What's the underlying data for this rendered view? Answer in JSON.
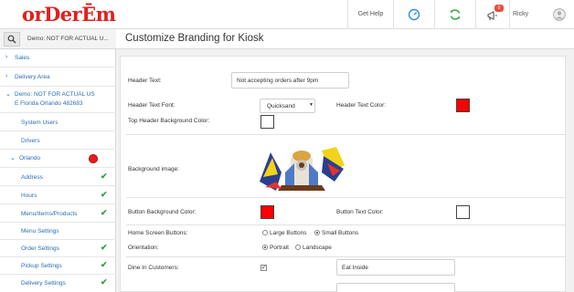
{
  "app": {
    "logo_text": "orDerĒm",
    "brand_color": "#e02020"
  },
  "topbar": {
    "help_label": "Get Help",
    "notification_count": "0",
    "user_name": "Ricky",
    "icons": [
      "speedometer-icon",
      "refresh-icon",
      "announcement-icon",
      "user-avatar-icon"
    ]
  },
  "sidebar": {
    "search_text": "Demo: NOT FOR ACTUAL U...",
    "items": [
      {
        "label": "Sales",
        "chevron": "›"
      },
      {
        "label": "Delivery Area",
        "chevron": "›"
      },
      {
        "label": "Demo: NOT FOR ACTUAL US",
        "label2": "E Florida Orlando 482683",
        "chevron": "⌄"
      },
      {
        "label": "System Users"
      },
      {
        "label": "Drivers"
      },
      {
        "label": "Orlando",
        "chevron": "⌄"
      },
      {
        "label": "Address",
        "check": "✔"
      },
      {
        "label": "Hours",
        "check": "✔"
      },
      {
        "label": "Menu/Items/Products",
        "check": "✔"
      },
      {
        "label": "Menu Settings"
      },
      {
        "label": "Order Settings",
        "check": "✔"
      },
      {
        "label": "Pickup Settings",
        "check": "✔"
      },
      {
        "label": "Delivery Settings",
        "check": "✔"
      }
    ]
  },
  "main": {
    "title": "Customize Branding for Kiosk",
    "form": {
      "header_text_label": "Header Text:",
      "header_text_value": "Not accepting orders after 9pm",
      "header_font_label": "Header Text Font:",
      "header_font_value": "Quicksand",
      "header_text_color_label": "Header Text Color:",
      "header_text_color": "#ff0000",
      "top_header_bg_label": "Top Header Background Color:",
      "top_header_bg_color": "#ffffff",
      "background_image_label": "Background image:",
      "button_bg_label": "Button Background Color:",
      "button_bg_color": "#ff0000",
      "button_text_color_label": "Button Text Color:",
      "button_text_color": "#ffffff",
      "home_buttons_label": "Home Screen Buttons:",
      "large_buttons_label": "Large Buttons",
      "small_buttons_label": "Small Buttons",
      "home_buttons_selected": "Small Buttons",
      "orientation_label": "Orientation:",
      "portrait_label": "Portrait",
      "landscape_label": "Landscape",
      "orientation_selected": "Portrait",
      "dine_in_label": "Dine In Customers:",
      "dine_in_checked": true,
      "dine_in_text": "Eat Inside"
    }
  }
}
